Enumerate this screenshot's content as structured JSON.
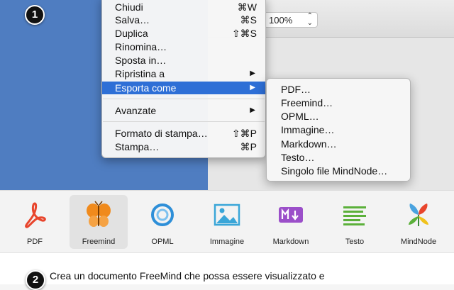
{
  "markers": {
    "step1": "1",
    "step2": "2"
  },
  "zoom": {
    "value": "100%"
  },
  "menu": {
    "items": [
      {
        "label": "Chiudi",
        "shortcut": "⌘W"
      },
      {
        "label": "Salva…",
        "shortcut": "⌘S"
      },
      {
        "label": "Duplica",
        "shortcut": "⇧⌘S"
      },
      {
        "label": "Rinomina…",
        "shortcut": ""
      },
      {
        "label": "Sposta in…",
        "shortcut": ""
      },
      {
        "label": "Ripristina a",
        "shortcut": "▶"
      },
      {
        "label": "Esporta come",
        "shortcut": "▶",
        "highlighted": true
      },
      {
        "label": "Avanzate",
        "shortcut": "▶"
      },
      {
        "label": "Formato di stampa…",
        "shortcut": "⇧⌘P"
      },
      {
        "label": "Stampa…",
        "shortcut": "⌘P"
      }
    ]
  },
  "submenu": {
    "items": [
      "PDF…",
      "Freemind…",
      "OPML…",
      "Immagine…",
      "Markdown…",
      "Testo…",
      "Singolo file MindNode…"
    ]
  },
  "formats": {
    "items": [
      {
        "label": "PDF",
        "icon": "pdf-icon",
        "color": "#e8452c"
      },
      {
        "label": "Freemind",
        "icon": "butterfly-icon",
        "color": "#f08a1c",
        "selected": true
      },
      {
        "label": "OPML",
        "icon": "opml-icon",
        "color": "#2e8fd8"
      },
      {
        "label": "Immagine",
        "icon": "image-icon",
        "color": "#3aa6d8"
      },
      {
        "label": "Markdown",
        "icon": "markdown-icon",
        "color": "#9b4fc9"
      },
      {
        "label": "Testo",
        "icon": "text-icon",
        "color": "#5bb03a"
      },
      {
        "label": "MindNode",
        "icon": "mindnode-icon",
        "color": "#4aa3df"
      }
    ]
  },
  "description": {
    "text": "Crea un documento FreeMind che possa essere visualizzato e"
  },
  "colors": {
    "accent": "#2e6fd6",
    "sidebar": "#4f7dc1"
  }
}
